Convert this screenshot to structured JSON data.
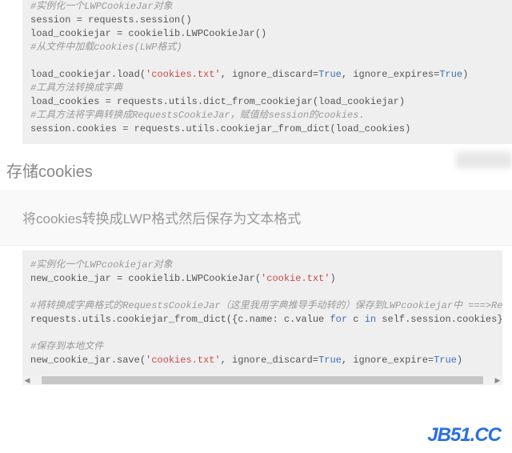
{
  "block1": {
    "c1": "#实例化一个LWPCookieJar对象",
    "l1a": "session = requests.session()",
    "l1b": "load_cookiejar = cookielib.LWPCookieJar()",
    "c2": "#从文件中加载cookies(LWP格式)",
    "l2a_pre": "load_cookiejar.load(",
    "l2a_str": "'cookies.txt'",
    "l2a_post1": ", ignore_discard=",
    "l2a_true1": "True",
    "l2a_post2": ", ignore_expires=",
    "l2a_true2": "True",
    "l2a_post3": ")",
    "c3": "#工具方法转换成字典",
    "l3": "load_cookies = requests.utils.dict_from_cookiejar(load_cookiejar)",
    "c4": "#工具方法将字典转换成RequestsCookieJar，赋值给session的cookies.",
    "l4": "session.cookies = requests.utils.cookiejar_from_dict(load_cookies)"
  },
  "heading": "存储cookies",
  "subheading": "将cookies转换成LWP格式然后保存为文本格式",
  "block2": {
    "c1": "#实例化一个LWPcookiejar对象",
    "l1_pre": "new_cookie_jar = cookielib.LWPCookieJar(",
    "l1_str": "'cookie.txt'",
    "l1_post": ")",
    "c2": "#将转换成字典格式的RequestsCookieJar（这里我用字典推导手动转的）保存到LWPcookiejar中 ===>RequestsCookieJar没有实现save()方法",
    "l2_pre": "requests.utils.cookiejar_from_dict({c.name: c.value ",
    "l2_for": "for",
    "l2_mid": " c ",
    "l2_in": "in",
    "l2_post": " self.session.cookies}, new_cookie_jar)",
    "c3": "#保存到本地文件",
    "l3_pre": "new_cookie_jar.save(",
    "l3_str": "'cookies.txt'",
    "l3_post1": ", ignore_discard=",
    "l3_true1": "True",
    "l3_post2": ", ignore_expire=",
    "l3_true2": "True",
    "l3_post3": ")"
  },
  "watermark": "JB51.CC"
}
